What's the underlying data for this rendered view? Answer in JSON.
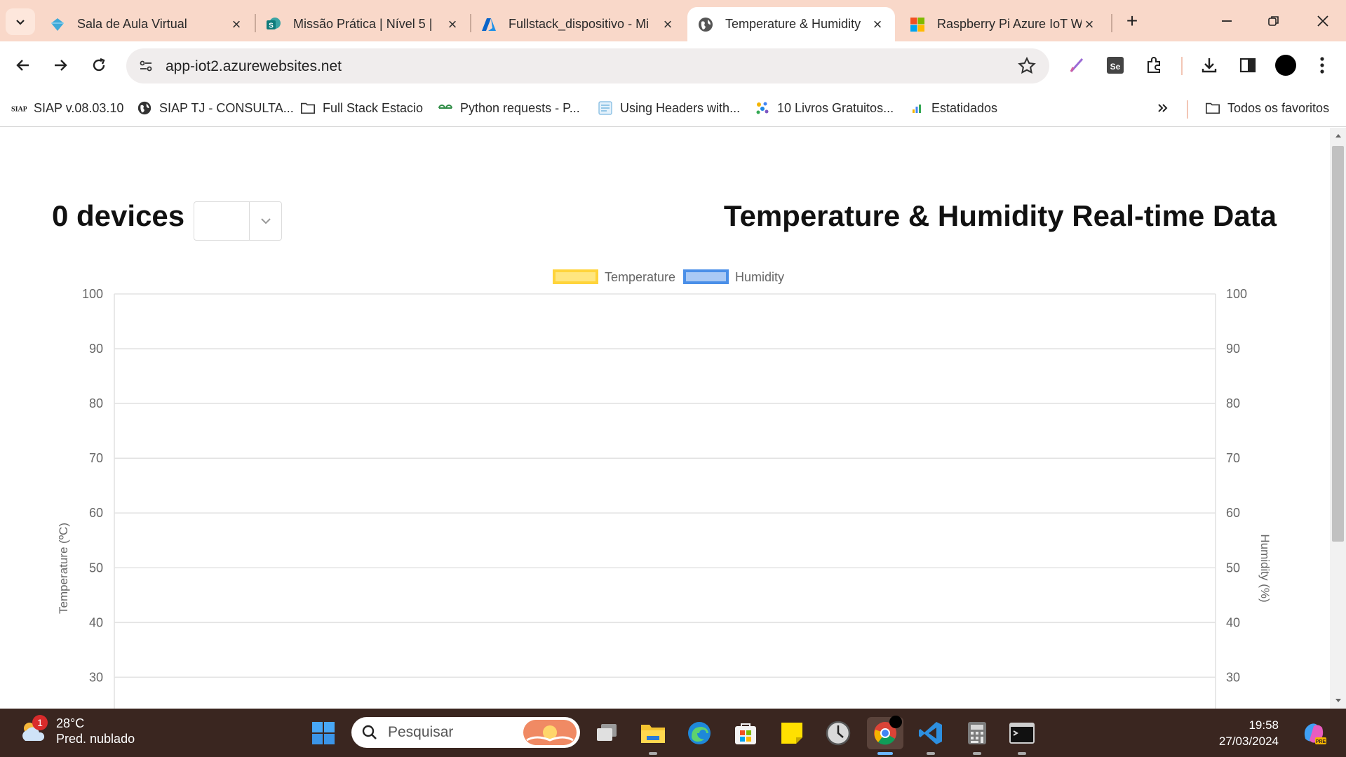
{
  "tabs": [
    {
      "title": "Sala de Aula Virtual",
      "icon": "diamond-icon",
      "active": false
    },
    {
      "title": "Missão Prática | Nível 5 |",
      "icon": "sharepoint-icon",
      "active": false
    },
    {
      "title": "Fullstack_dispositivo - Mi",
      "icon": "azure-icon",
      "active": false
    },
    {
      "title": "Temperature & Humidity",
      "icon": "globe-icon",
      "active": true
    },
    {
      "title": "Raspberry Pi Azure IoT W",
      "icon": "microsoft-icon",
      "active": false
    }
  ],
  "address_bar": {
    "url": "app-iot2.azurewebsites.net"
  },
  "bookmarks": [
    {
      "label": "SIAP v.08.03.10",
      "icon": "siap-icon"
    },
    {
      "label": "SIAP TJ - CONSULTA...",
      "icon": "globe-icon"
    },
    {
      "label": "Full Stack Estacio",
      "icon": "folder-icon"
    },
    {
      "label": "Python requests - P...",
      "icon": "geeks-icon"
    },
    {
      "label": "Using Headers with...",
      "icon": "page-icon"
    },
    {
      "label": "10 Livros Gratuitos...",
      "icon": "dots-icon"
    },
    {
      "label": "Estatidados",
      "icon": "bars-icon"
    }
  ],
  "bookmarks_all": "Todos os favoritos",
  "page": {
    "device_count": "0 devices",
    "title": "Temperature & Humidity Real-time Data"
  },
  "chart_data": {
    "type": "line",
    "series": [
      {
        "name": "Temperature",
        "color": "#ffd43b",
        "values": []
      },
      {
        "name": "Humidity",
        "color": "#4a8fe8",
        "values": []
      }
    ],
    "y_left": {
      "label": "Temperature (ºC)",
      "ticks": [
        100,
        90,
        80,
        70,
        60,
        50,
        40,
        30
      ]
    },
    "y_right": {
      "label": "Humidity (%)",
      "ticks": [
        100,
        90,
        80,
        70,
        60,
        50,
        40,
        30
      ]
    },
    "ylim": [
      30,
      100
    ],
    "grid": true,
    "legend": "top-center"
  },
  "taskbar": {
    "weather_temp": "28°C",
    "weather_cond": "Pred. nublado",
    "weather_badge": "1",
    "search_placeholder": "Pesquisar",
    "time": "19:58",
    "date": "27/03/2024"
  }
}
